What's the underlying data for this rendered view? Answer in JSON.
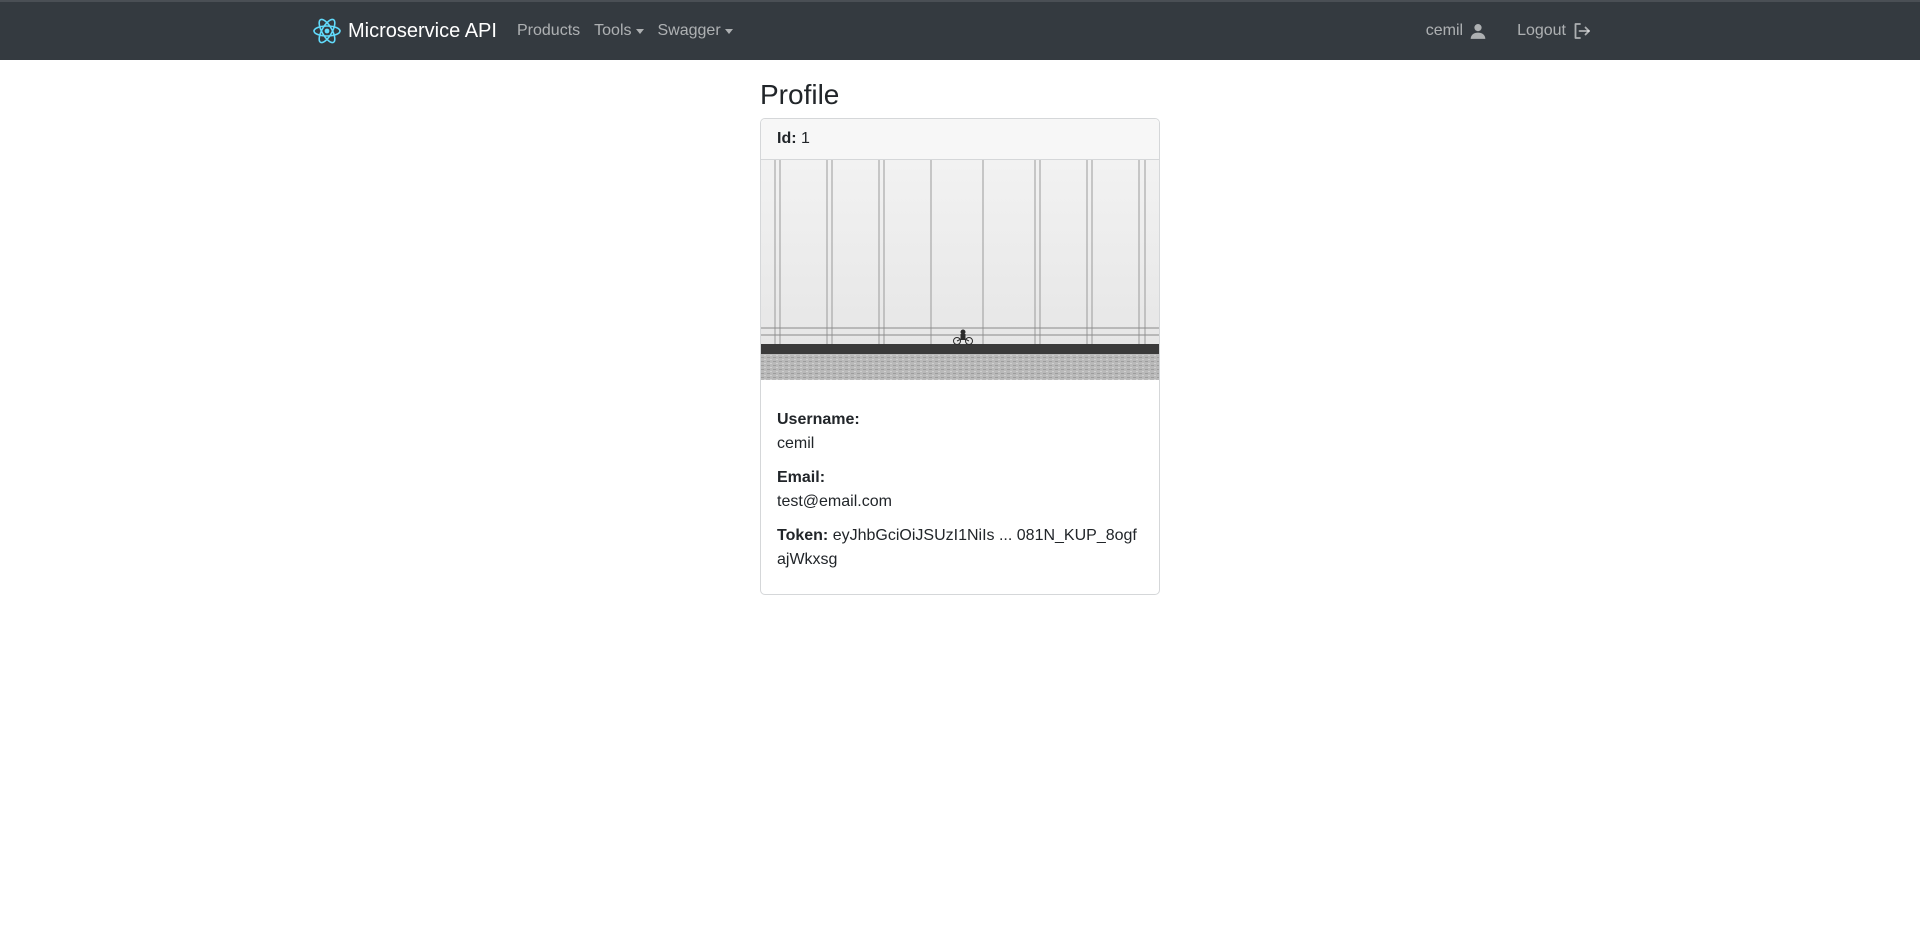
{
  "navbar": {
    "brand": "Microservice API",
    "links": [
      {
        "label": "Products",
        "dropdown": false
      },
      {
        "label": "Tools",
        "dropdown": true
      },
      {
        "label": "Swagger",
        "dropdown": true
      }
    ],
    "user": "cemil",
    "logout": "Logout",
    "icons": {
      "brand": "react-logo-icon",
      "user": "person-icon",
      "logout": "logout-icon"
    },
    "colors": {
      "background": "#343a40",
      "brand_logo": "#61dafb"
    }
  },
  "page": {
    "title": "Profile"
  },
  "profile_card": {
    "id_label": "Id:",
    "id_value": "1",
    "image": "bridge-cyclist-photo",
    "username_label": "Username:",
    "username_value": "cemil",
    "email_label": "Email:",
    "email_value": "test@email.com",
    "token_label": "Token:",
    "token_value": "eyJhbGciOiJSUzI1NiIs ... 081N_KUP_8ogfajWkxsg"
  }
}
